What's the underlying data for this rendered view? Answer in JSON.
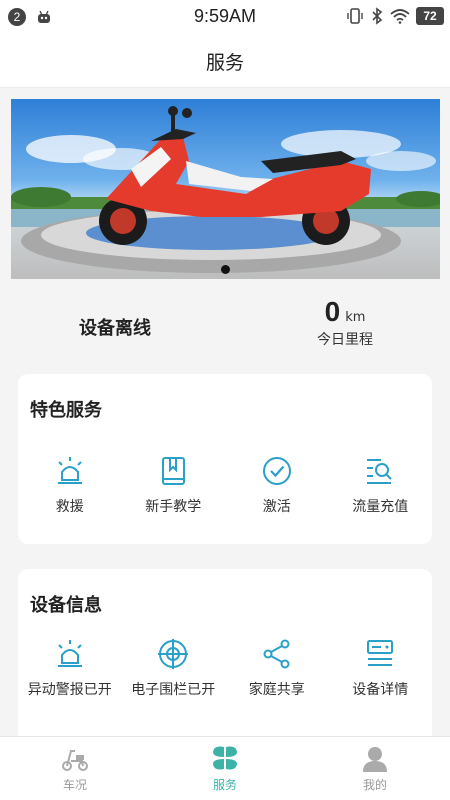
{
  "status_bar": {
    "notification_count": "2",
    "time": "9:59AM",
    "battery": "72"
  },
  "header": {
    "title": "服务"
  },
  "banner": {
    "icon": "scooter-image",
    "current_slide": 1
  },
  "device": {
    "status": "设备离线",
    "mileage_value": "0",
    "mileage_unit": "km",
    "mileage_label": "今日里程"
  },
  "featured_services": {
    "title": "特色服务",
    "items": [
      {
        "label": "救援",
        "icon": "siren-icon"
      },
      {
        "label": "新手教学",
        "icon": "book-icon"
      },
      {
        "label": "激活",
        "icon": "check-circle-icon"
      },
      {
        "label": "流量充值",
        "icon": "search-list-icon"
      }
    ]
  },
  "device_info": {
    "title": "设备信息",
    "items": [
      {
        "label": "异动警报已开",
        "icon": "alarm-icon"
      },
      {
        "label": "电子围栏已开",
        "icon": "target-icon"
      },
      {
        "label": "家庭共享",
        "icon": "share-icon"
      },
      {
        "label": "设备详情",
        "icon": "device-detail-icon"
      }
    ]
  },
  "tabbar": {
    "items": [
      {
        "label": "车况",
        "icon": "scooter-icon",
        "active": false
      },
      {
        "label": "服务",
        "icon": "clover-icon",
        "active": true
      },
      {
        "label": "我的",
        "icon": "user-icon",
        "active": false
      }
    ]
  },
  "colors": {
    "accent": "#3cb3a6",
    "icon_blue": "#2aa0c8"
  }
}
